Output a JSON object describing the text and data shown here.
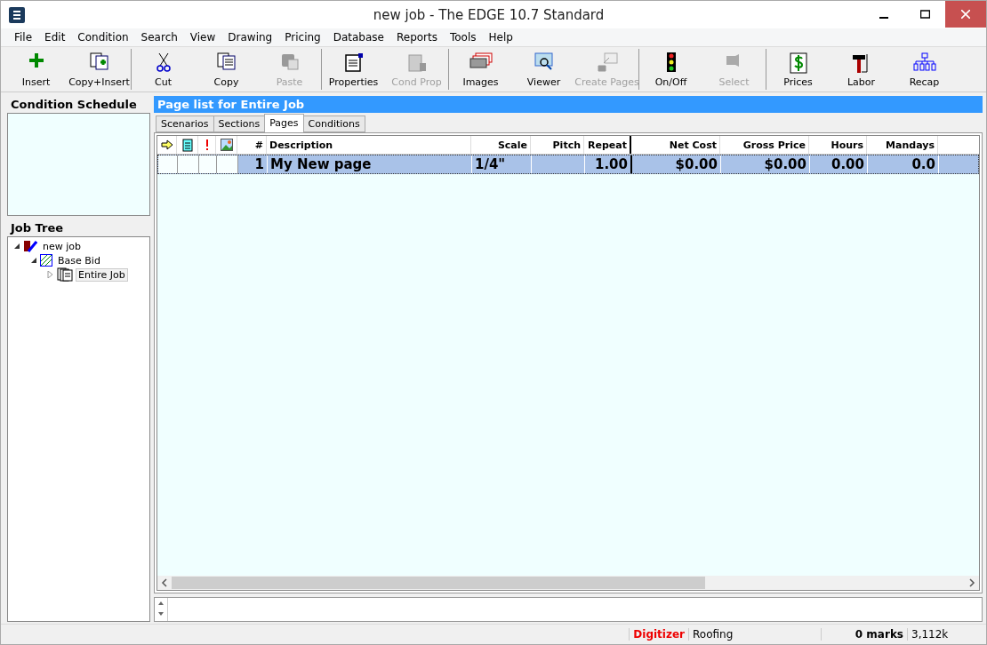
{
  "window": {
    "title": "new job - The EDGE 10.7 Standard"
  },
  "menu": [
    "File",
    "Edit",
    "Condition",
    "Search",
    "View",
    "Drawing",
    "Pricing",
    "Database",
    "Reports",
    "Tools",
    "Help"
  ],
  "toolbar_groups": [
    [
      {
        "label": "Insert",
        "disabled": false
      },
      {
        "label": "Copy+Insert",
        "disabled": false
      }
    ],
    [
      {
        "label": "Cut",
        "disabled": false
      },
      {
        "label": "Copy",
        "disabled": false
      },
      {
        "label": "Paste",
        "disabled": true
      }
    ],
    [
      {
        "label": "Properties",
        "disabled": false
      },
      {
        "label": "Cond Prop",
        "disabled": true
      }
    ],
    [
      {
        "label": "Images",
        "disabled": false
      },
      {
        "label": "Viewer",
        "disabled": false
      },
      {
        "label": "Create Pages",
        "disabled": true
      }
    ],
    [
      {
        "label": "On/Off",
        "disabled": false
      },
      {
        "label": "Select",
        "disabled": true
      }
    ],
    [
      {
        "label": "Prices",
        "disabled": false
      },
      {
        "label": "Labor",
        "disabled": false
      },
      {
        "label": "Recap",
        "disabled": false
      }
    ]
  ],
  "condition_schedule": {
    "title": "Condition Schedule"
  },
  "job_tree": {
    "title": "Job Tree",
    "items": [
      {
        "label": "new job",
        "expanded": true,
        "selected": false,
        "children": [
          {
            "label": "Base Bid",
            "expanded": true,
            "selected": false,
            "children": [
              {
                "label": "Entire Job",
                "expanded": false,
                "selected": true
              }
            ]
          }
        ]
      }
    ]
  },
  "page_list": {
    "title": "Page list for Entire Job",
    "tabs": [
      {
        "label": "Scenarios",
        "selected": false
      },
      {
        "label": "Sections",
        "selected": false
      },
      {
        "label": "Pages",
        "selected": true
      },
      {
        "label": "Conditions",
        "selected": false
      }
    ],
    "columns": [
      "#",
      "Description",
      "Scale",
      "Pitch",
      "Repeat",
      "Net Cost",
      "Gross Price",
      "Hours",
      "Mandays"
    ],
    "rows": [
      {
        "selected": true,
        "cells": [
          "1",
          "My New page",
          "1/4\"",
          "",
          "1.00",
          "$0.00",
          "$0.00",
          "0.00",
          "0.0"
        ]
      }
    ]
  },
  "status_bar": {
    "mode": "Digitizer",
    "trade": "Roofing",
    "marks": "0 marks",
    "memory": "3,112k"
  }
}
